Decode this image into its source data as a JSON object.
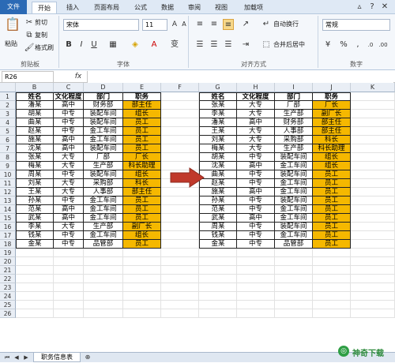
{
  "menu": {
    "tabs": [
      "文件",
      "开始",
      "插入",
      "页面布局",
      "公式",
      "数据",
      "审阅",
      "视图",
      "加载项"
    ]
  },
  "ribbon": {
    "clipboard": {
      "paste": "粘贴",
      "cut": "剪切",
      "copy": "复制",
      "format_painter": "格式刷",
      "label": "剪贴板"
    },
    "font": {
      "font_name": "宋体",
      "font_size": "11",
      "label": "字体"
    },
    "alignment": {
      "wrap": "自动换行",
      "merge": "合并后居中",
      "label": "对齐方式"
    },
    "number": {
      "format": "常规",
      "label": "数字"
    }
  },
  "formula_bar": {
    "name_box": "R26",
    "fx": "fx",
    "value": ""
  },
  "columns": [
    "B",
    "C",
    "D",
    "E",
    "F",
    "G",
    "H",
    "I",
    "J",
    "K"
  ],
  "rows": [
    "1",
    "2",
    "3",
    "4",
    "5",
    "6",
    "7",
    "8",
    "9",
    "10",
    "11",
    "12",
    "13",
    "14",
    "15",
    "16",
    "17",
    "18",
    "19",
    "20",
    "21",
    "22",
    "23",
    "24",
    "25",
    "26"
  ],
  "left_table": {
    "headers": [
      "姓名",
      "文化程度",
      "部门",
      "职务"
    ],
    "rows": [
      [
        "潘某",
        "高中",
        "财务部",
        "部主任"
      ],
      [
        "胡某",
        "中专",
        "装配车间",
        "组长"
      ],
      [
        "曲某",
        "中专",
        "装配车间",
        "员工"
      ],
      [
        "赵某",
        "中专",
        "金工车间",
        "员工"
      ],
      [
        "施某",
        "高中",
        "金工车间",
        "员工"
      ],
      [
        "沈某",
        "高中",
        "装配车间",
        "员工"
      ],
      [
        "张某",
        "大专",
        "厂部",
        "厂长"
      ],
      [
        "梅某",
        "大专",
        "生产部",
        "科长助理"
      ],
      [
        "周某",
        "中专",
        "装配车间",
        "组长"
      ],
      [
        "刘某",
        "大专",
        "采购部",
        "科长"
      ],
      [
        "王某",
        "大专",
        "人事部",
        "部主任"
      ],
      [
        "孙某",
        "中专",
        "金工车间",
        "员工"
      ],
      [
        "范某",
        "高中",
        "金工车间",
        "员工"
      ],
      [
        "武某",
        "高中",
        "金工车间",
        "员工"
      ],
      [
        "李某",
        "大专",
        "生产部",
        "副厂长"
      ],
      [
        "钱某",
        "中专",
        "金工车间",
        "组长"
      ],
      [
        "金某",
        "中专",
        "品管部",
        "员工"
      ]
    ]
  },
  "right_table": {
    "headers": [
      "姓名",
      "文化程度",
      "部门",
      "职务"
    ],
    "rows": [
      [
        "张某",
        "大专",
        "厂部",
        "厂长"
      ],
      [
        "李某",
        "大专",
        "生产部",
        "副厂长"
      ],
      [
        "潘某",
        "高中",
        "财务部",
        "部主任"
      ],
      [
        "王某",
        "大专",
        "人事部",
        "部主任"
      ],
      [
        "刘某",
        "大专",
        "采购部",
        "科长"
      ],
      [
        "梅某",
        "大专",
        "生产部",
        "科长助理"
      ],
      [
        "胡某",
        "中专",
        "装配车间",
        "组长"
      ],
      [
        "沈某",
        "高中",
        "金工车间",
        "组长"
      ],
      [
        "曲某",
        "中专",
        "装配车间",
        "员工"
      ],
      [
        "赵某",
        "中专",
        "金工车间",
        "员工"
      ],
      [
        "施某",
        "高中",
        "金工车间",
        "员工"
      ],
      [
        "孙某",
        "中专",
        "装配车间",
        "员工"
      ],
      [
        "范某",
        "中专",
        "金工车间",
        "员工"
      ],
      [
        "武某",
        "高中",
        "金工车间",
        "员工"
      ],
      [
        "周某",
        "中专",
        "装配车间",
        "员工"
      ],
      [
        "钱某",
        "中专",
        "金工车间",
        "员工"
      ],
      [
        "金某",
        "中专",
        "品管部",
        "员工"
      ]
    ]
  },
  "sheet_tab": "职务信息表",
  "watermark": "神奇下载",
  "colors": {
    "highlight": "#f5b800",
    "arrow": "#c0392b",
    "ribbon_accent": "#2b6ab5"
  }
}
